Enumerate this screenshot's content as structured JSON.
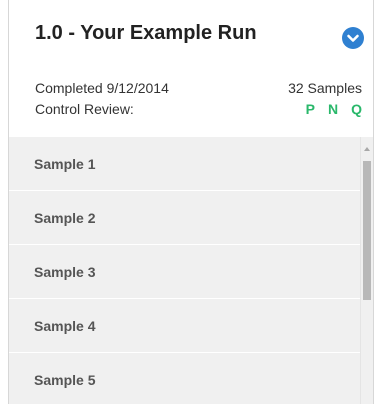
{
  "run": {
    "title": "1.0 - Your Example Run",
    "completed": "Completed 9/12/2014",
    "sample_count": "32 Samples",
    "control_review_label": "Control Review:",
    "flags": [
      "P",
      "N",
      "Q"
    ],
    "expand_icon": "chevron-down-circle-icon"
  },
  "samples": [
    "Sample 1",
    "Sample 2",
    "Sample 3",
    "Sample 4",
    "Sample 5"
  ],
  "colors": {
    "accent": "#2f80d1",
    "flag": "#2ab86b",
    "list_bg": "#f0f0f0"
  }
}
